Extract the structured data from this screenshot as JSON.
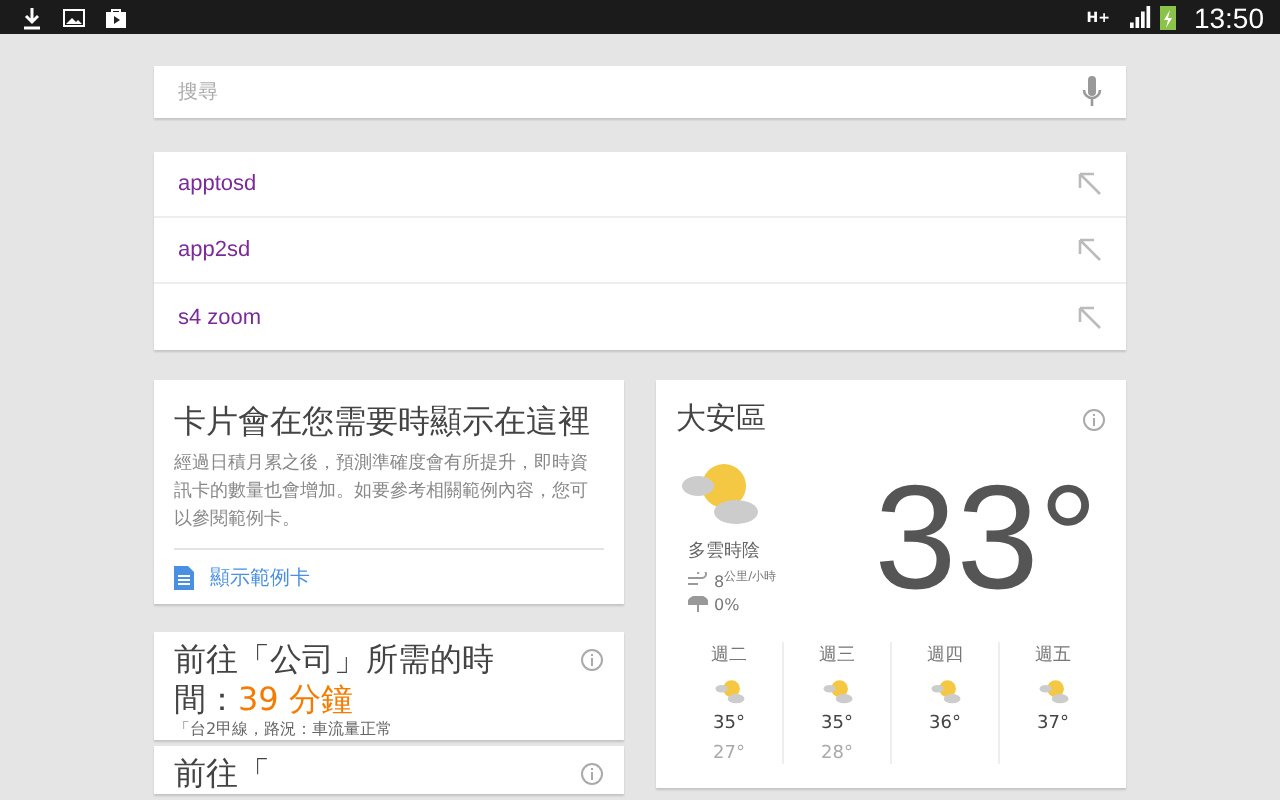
{
  "status_bar": {
    "time": "13:50",
    "network": "H+"
  },
  "search": {
    "placeholder": "搜尋"
  },
  "suggestions": [
    {
      "text": "apptosd"
    },
    {
      "text": "app2sd"
    },
    {
      "text": "s4 zoom"
    }
  ],
  "intro_card": {
    "title": "卡片會在您需要時顯示在這裡",
    "body": "經過日積月累之後，預測準確度會有所提升，即時資訊卡的數量也會增加。如要參考相關範例內容，您可以參閱範例卡。",
    "link": "顯示範例卡"
  },
  "commute_cards": [
    {
      "title": "前往「公司」所需的時間：",
      "duration": "39 分鐘",
      "detail": "「台2甲線，路況：車流量正常"
    },
    {
      "title": "前往「"
    }
  ],
  "weather": {
    "location": "大安區",
    "condition": "多雲時陰",
    "wind": "8",
    "wind_unit": "公里/小時",
    "rain": "0%",
    "temperature": "33°",
    "forecast": [
      {
        "day": "週二",
        "high": "35°",
        "low": "27°"
      },
      {
        "day": "週三",
        "high": "35°",
        "low": "28°"
      },
      {
        "day": "週四",
        "high": "36°"
      },
      {
        "day": "週五",
        "high": "37°"
      }
    ]
  }
}
